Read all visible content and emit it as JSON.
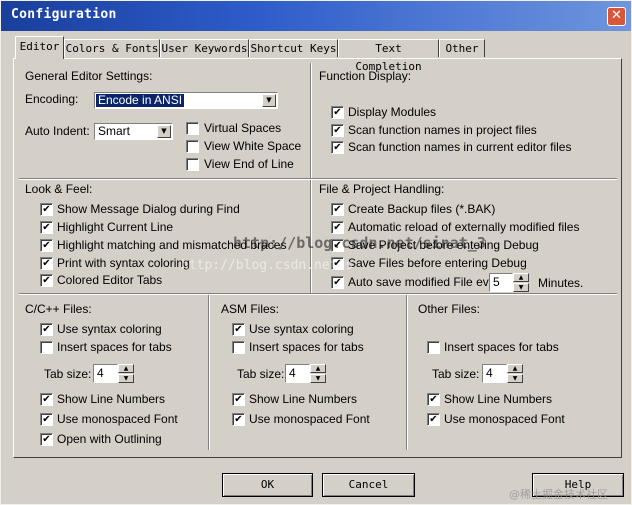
{
  "window": {
    "title": "Configuration",
    "close_glyph": "✕"
  },
  "tabs": [
    {
      "label": "Editor",
      "active": true
    },
    {
      "label": "Colors & Fonts",
      "active": false
    },
    {
      "label": "User Keywords",
      "active": false
    },
    {
      "label": "Shortcut Keys",
      "active": false
    },
    {
      "label": "Text Completion",
      "active": false
    },
    {
      "label": "Other",
      "active": false
    }
  ],
  "general": {
    "heading": "General Editor Settings:",
    "encoding_label": "Encoding:",
    "encoding_value": "Encode in ANSI",
    "auto_indent_label": "Auto Indent:",
    "auto_indent_value": "Smart",
    "virtual_spaces": {
      "label": "Virtual Spaces",
      "checked": false
    },
    "view_white_space": {
      "label": "View White Space",
      "checked": false
    },
    "view_end_of_line": {
      "label": "View End of Line",
      "checked": false
    }
  },
  "function_display": {
    "heading": "Function Display:",
    "items": [
      {
        "label": "Display Modules",
        "checked": true
      },
      {
        "label": "Scan function names in project files",
        "checked": true
      },
      {
        "label": "Scan function names in current editor files",
        "checked": true
      }
    ]
  },
  "look_feel": {
    "heading": "Look & Feel:",
    "items": [
      {
        "label": "Show Message Dialog during Find",
        "checked": true
      },
      {
        "label": "Highlight Current Line",
        "checked": true
      },
      {
        "label": "Highlight matching and mismatched braces",
        "checked": true
      },
      {
        "label": "Print with syntax coloring",
        "checked": true
      },
      {
        "label": "Colored Editor Tabs",
        "checked": true
      }
    ]
  },
  "file_project": {
    "heading": "File & Project Handling:",
    "items": [
      {
        "label": "Create Backup files (*.BAK)",
        "checked": true
      },
      {
        "label": "Automatic reload of externally modified files",
        "checked": true
      },
      {
        "label": "Save Project before entering Debug",
        "checked": true
      },
      {
        "label": "Save Files before entering Debug",
        "checked": true
      }
    ],
    "auto_save": {
      "label": "Auto save modified File every",
      "checked": true,
      "value": "5",
      "suffix": "Minutes."
    }
  },
  "cpp_files": {
    "heading": "C/C++ Files:",
    "use_syntax_coloring": {
      "label": "Use syntax coloring",
      "checked": true
    },
    "insert_spaces": {
      "label": "Insert spaces for tabs",
      "checked": false
    },
    "tab_size_label": "Tab size:",
    "tab_size_value": "4",
    "show_line_numbers": {
      "label": "Show Line Numbers",
      "checked": true
    },
    "use_monospaced": {
      "label": "Use monospaced Font",
      "checked": true
    },
    "open_with_outlining": {
      "label": "Open with Outlining",
      "checked": true
    }
  },
  "asm_files": {
    "heading": "ASM Files:",
    "use_syntax_coloring": {
      "label": "Use syntax coloring",
      "checked": true
    },
    "insert_spaces": {
      "label": "Insert spaces for tabs",
      "checked": false
    },
    "tab_size_label": "Tab size:",
    "tab_size_value": "4",
    "show_line_numbers": {
      "label": "Show Line Numbers",
      "checked": true
    },
    "use_monospaced": {
      "label": "Use monospaced Font",
      "checked": true
    }
  },
  "other_files": {
    "heading": "Other Files:",
    "insert_spaces": {
      "label": "Insert spaces for tabs",
      "checked": false
    },
    "tab_size_label": "Tab size:",
    "tab_size_value": "4",
    "show_line_numbers": {
      "label": "Show Line Numbers",
      "checked": true
    },
    "use_monospaced": {
      "label": "Use monospaced Font",
      "checked": true
    }
  },
  "buttons": {
    "ok": "OK",
    "cancel": "Cancel",
    "help": "Help"
  },
  "watermark": {
    "primary": "http://blog.csdn.net/sinat_3",
    "secondary": "http://blog.csdn.net/s",
    "corner": "@稀土掘金技术社区"
  },
  "glyphs": {
    "check": "✔",
    "down_arrow": "▼",
    "up_arrow": "▲"
  },
  "colors": {
    "dialog_bg": "#d4d0c8",
    "title_start": "#1a3f9c",
    "title_end": "#6f95de",
    "selection": "#0a246a",
    "close": "#d8573a"
  }
}
